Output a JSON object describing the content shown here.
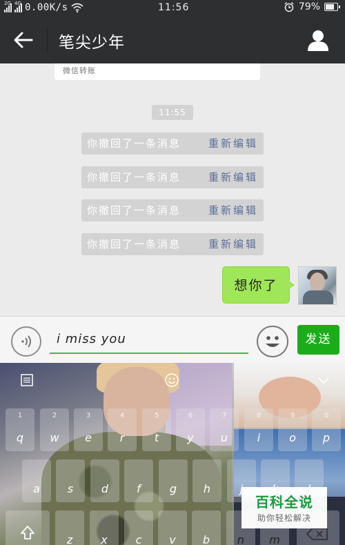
{
  "status_bar": {
    "network_1": "2G",
    "network_2": "4G",
    "speed": "0.00K/s",
    "time": "11:56",
    "battery_percent": "79%",
    "battery_level": 0.79
  },
  "header": {
    "title": "笔尖少年"
  },
  "chat": {
    "top_card_text": "微信转账",
    "timestamp": "11:55",
    "recalled_messages": [
      {
        "text": "你撤回了一条消息",
        "action": "重新编辑"
      },
      {
        "text": "你撤回了一条消息",
        "action": "重新编辑"
      },
      {
        "text": "你撤回了一条消息",
        "action": "重新编辑"
      },
      {
        "text": "你撤回了一条消息",
        "action": "重新编辑"
      }
    ],
    "sent_message": "想你了"
  },
  "input_bar": {
    "text_value": "i miss you",
    "send_label": "发送"
  },
  "keyboard": {
    "row1": [
      {
        "main": "q",
        "num": "1"
      },
      {
        "main": "w",
        "num": "2"
      },
      {
        "main": "e",
        "num": "3"
      },
      {
        "main": "r",
        "num": "4"
      },
      {
        "main": "t",
        "num": "5"
      },
      {
        "main": "y",
        "num": "6"
      },
      {
        "main": "u",
        "num": "7"
      },
      {
        "main": "i",
        "num": "8"
      },
      {
        "main": "o",
        "num": "9"
      },
      {
        "main": "p",
        "num": "0"
      }
    ],
    "row2": [
      "a",
      "s",
      "d",
      "f",
      "g",
      "h",
      "j",
      "k",
      "l"
    ],
    "row3": [
      "z",
      "x",
      "c",
      "v",
      "b",
      "n",
      "m"
    ]
  },
  "watermark": {
    "title": "百科全说",
    "subtitle": "助你轻松解决"
  },
  "colors": {
    "topbar": "#2e2f31",
    "chat_bg": "#ebebeb",
    "bubble_green": "#9fe658",
    "send_green": "#1aad19",
    "recall_action_blue": "#5b6f99",
    "watermark_green": "#1a9a3c"
  }
}
